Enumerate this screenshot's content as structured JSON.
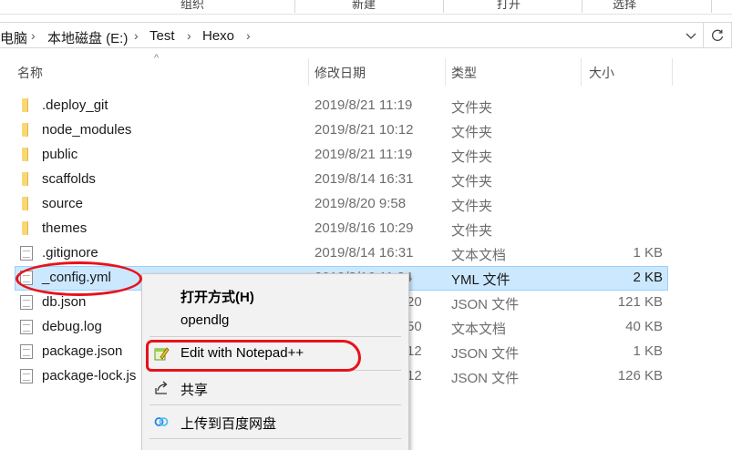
{
  "ribbon": {
    "groups": [
      "组织",
      "新建",
      "打开",
      "选择"
    ]
  },
  "address": {
    "crumbs": [
      "电脑",
      "本地磁盘 (E:)",
      "Test",
      "Hexo"
    ]
  },
  "columns": {
    "name": "名称",
    "date": "修改日期",
    "type": "类型",
    "size": "大小"
  },
  "files": [
    {
      "name": ".deploy_git",
      "date": "2019/8/21 11:19",
      "type": "文件夹",
      "size": "",
      "icon": "folder-icon"
    },
    {
      "name": "node_modules",
      "date": "2019/8/21 10:12",
      "type": "文件夹",
      "size": "",
      "icon": "folder-icon"
    },
    {
      "name": "public",
      "date": "2019/8/21 11:19",
      "type": "文件夹",
      "size": "",
      "icon": "folder-icon"
    },
    {
      "name": "scaffolds",
      "date": "2019/8/14 16:31",
      "type": "文件夹",
      "size": "",
      "icon": "folder-icon"
    },
    {
      "name": "source",
      "date": "2019/8/20 9:58",
      "type": "文件夹",
      "size": "",
      "icon": "folder-icon"
    },
    {
      "name": "themes",
      "date": "2019/8/16 10:29",
      "type": "文件夹",
      "size": "",
      "icon": "folder-icon"
    },
    {
      "name": ".gitignore",
      "date": "2019/8/14 16:31",
      "type": "文本文档",
      "size": "1 KB",
      "icon": "document-icon"
    },
    {
      "name": "_config.yml",
      "date": "2019/8/16 11:34",
      "type": "YML 文件",
      "size": "2 KB",
      "icon": "document-icon"
    },
    {
      "name": "db.json",
      "date": "20",
      "type": "JSON 文件",
      "size": "121 KB",
      "icon": "document-icon"
    },
    {
      "name": "debug.log",
      "date": "50",
      "type": "文本文档",
      "size": "40 KB",
      "icon": "document-icon"
    },
    {
      "name": "package.json",
      "date": "12",
      "type": "JSON 文件",
      "size": "1 KB",
      "icon": "document-icon"
    },
    {
      "name": "package-lock.js",
      "date": "12",
      "type": "JSON 文件",
      "size": "126 KB",
      "icon": "document-icon"
    }
  ],
  "context_menu": {
    "open_with": "打开方式(H)",
    "opendlg": "opendlg",
    "edit_notepadpp": "Edit with Notepad++",
    "share": "共享",
    "baidu_upload": "上传到百度网盘"
  },
  "colors": {
    "selection": "#cce8ff",
    "annotation": "#e8121a",
    "folder": "#f8d775"
  }
}
